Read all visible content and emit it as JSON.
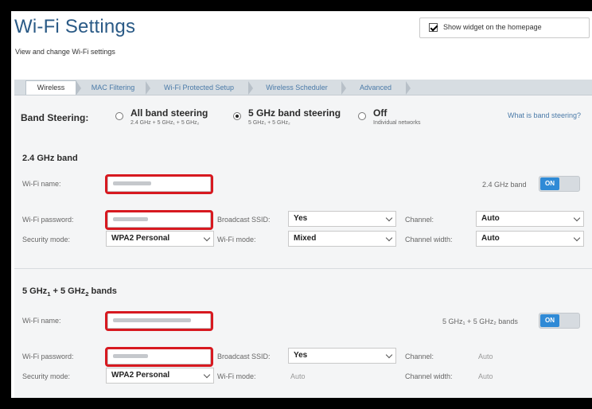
{
  "page": {
    "title": "Wi-Fi Settings",
    "subtitle": "View and change Wi-Fi settings"
  },
  "widget": {
    "label": "Show widget on the homepage",
    "checked": true
  },
  "tabs": [
    {
      "label": "Wireless",
      "active": true
    },
    {
      "label": "MAC Filtering"
    },
    {
      "label": "Wi-Fi Protected Setup"
    },
    {
      "label": "Wireless Scheduler"
    },
    {
      "label": "Advanced"
    }
  ],
  "band_steering": {
    "label": "Band Steering:",
    "options": [
      {
        "title": "All band steering",
        "sub": "2.4 GHz + 5 GHz₁ + 5 GHz₂",
        "selected": false
      },
      {
        "title": "5 GHz band steering",
        "sub": "5 GHz₁ + 5 GHz₂",
        "selected": true
      },
      {
        "title": "Off",
        "sub": "Individual networks",
        "selected": false
      }
    ],
    "help_link": "What is band steering?"
  },
  "band24": {
    "heading": "2.4 GHz band",
    "wifi_name_label": "Wi-Fi name:",
    "toggle_label": "2.4 GHz band",
    "toggle_state": "ON",
    "password_label": "Wi-Fi password:",
    "broadcast_label": "Broadcast SSID:",
    "broadcast_value": "Yes",
    "channel_label": "Channel:",
    "channel_value": "Auto",
    "security_label": "Security mode:",
    "security_value": "WPA2 Personal",
    "wifi_mode_label": "Wi-Fi mode:",
    "wifi_mode_value": "Mixed",
    "channel_width_label": "Channel width:",
    "channel_width_value": "Auto"
  },
  "band5": {
    "heading_main": "5 GHz",
    "heading_sub1": "1",
    "heading_mid": " + 5 GHz",
    "heading_sub2": "2",
    "heading_end": " bands",
    "wifi_name_label": "Wi-Fi name:",
    "toggle_label": "5 GHz₁ + 5 GHz₂ bands",
    "toggle_state": "ON",
    "password_label": "Wi-Fi password:",
    "broadcast_label": "Broadcast SSID:",
    "broadcast_value": "Yes",
    "channel_label": "Channel:",
    "channel_value": "Auto",
    "security_label": "Security mode:",
    "security_value": "WPA2 Personal",
    "wifi_mode_label": "Wi-Fi mode:",
    "wifi_mode_value": "Auto",
    "channel_width_label": "Channel width:",
    "channel_width_value": "Auto"
  },
  "colors": {
    "title": "#2a5a86",
    "link": "#4a7aa8",
    "highlight": "#d71920",
    "toggle_on": "#2f8ad6"
  }
}
